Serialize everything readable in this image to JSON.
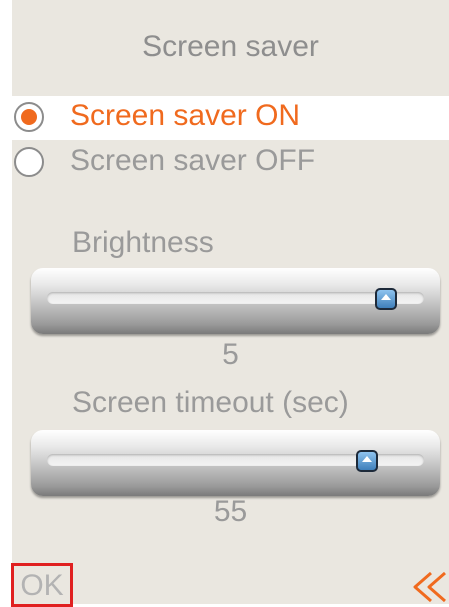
{
  "title": "Screen saver",
  "options": [
    {
      "label": "Screen saver ON",
      "selected": true
    },
    {
      "label": "Screen saver OFF",
      "selected": false
    }
  ],
  "sliders": [
    {
      "label": "Brightness",
      "value": "5",
      "fraction": 0.9
    },
    {
      "label": "Screen timeout (sec)",
      "value": "55",
      "fraction": 0.85
    }
  ],
  "footer": {
    "ok_label": "OK",
    "back_icon": "double-chevron-left-icon"
  },
  "colors": {
    "accent": "#f06a1e",
    "background": "#eae7e0",
    "text": "#8e8e8e",
    "focus_border": "#e02020"
  }
}
